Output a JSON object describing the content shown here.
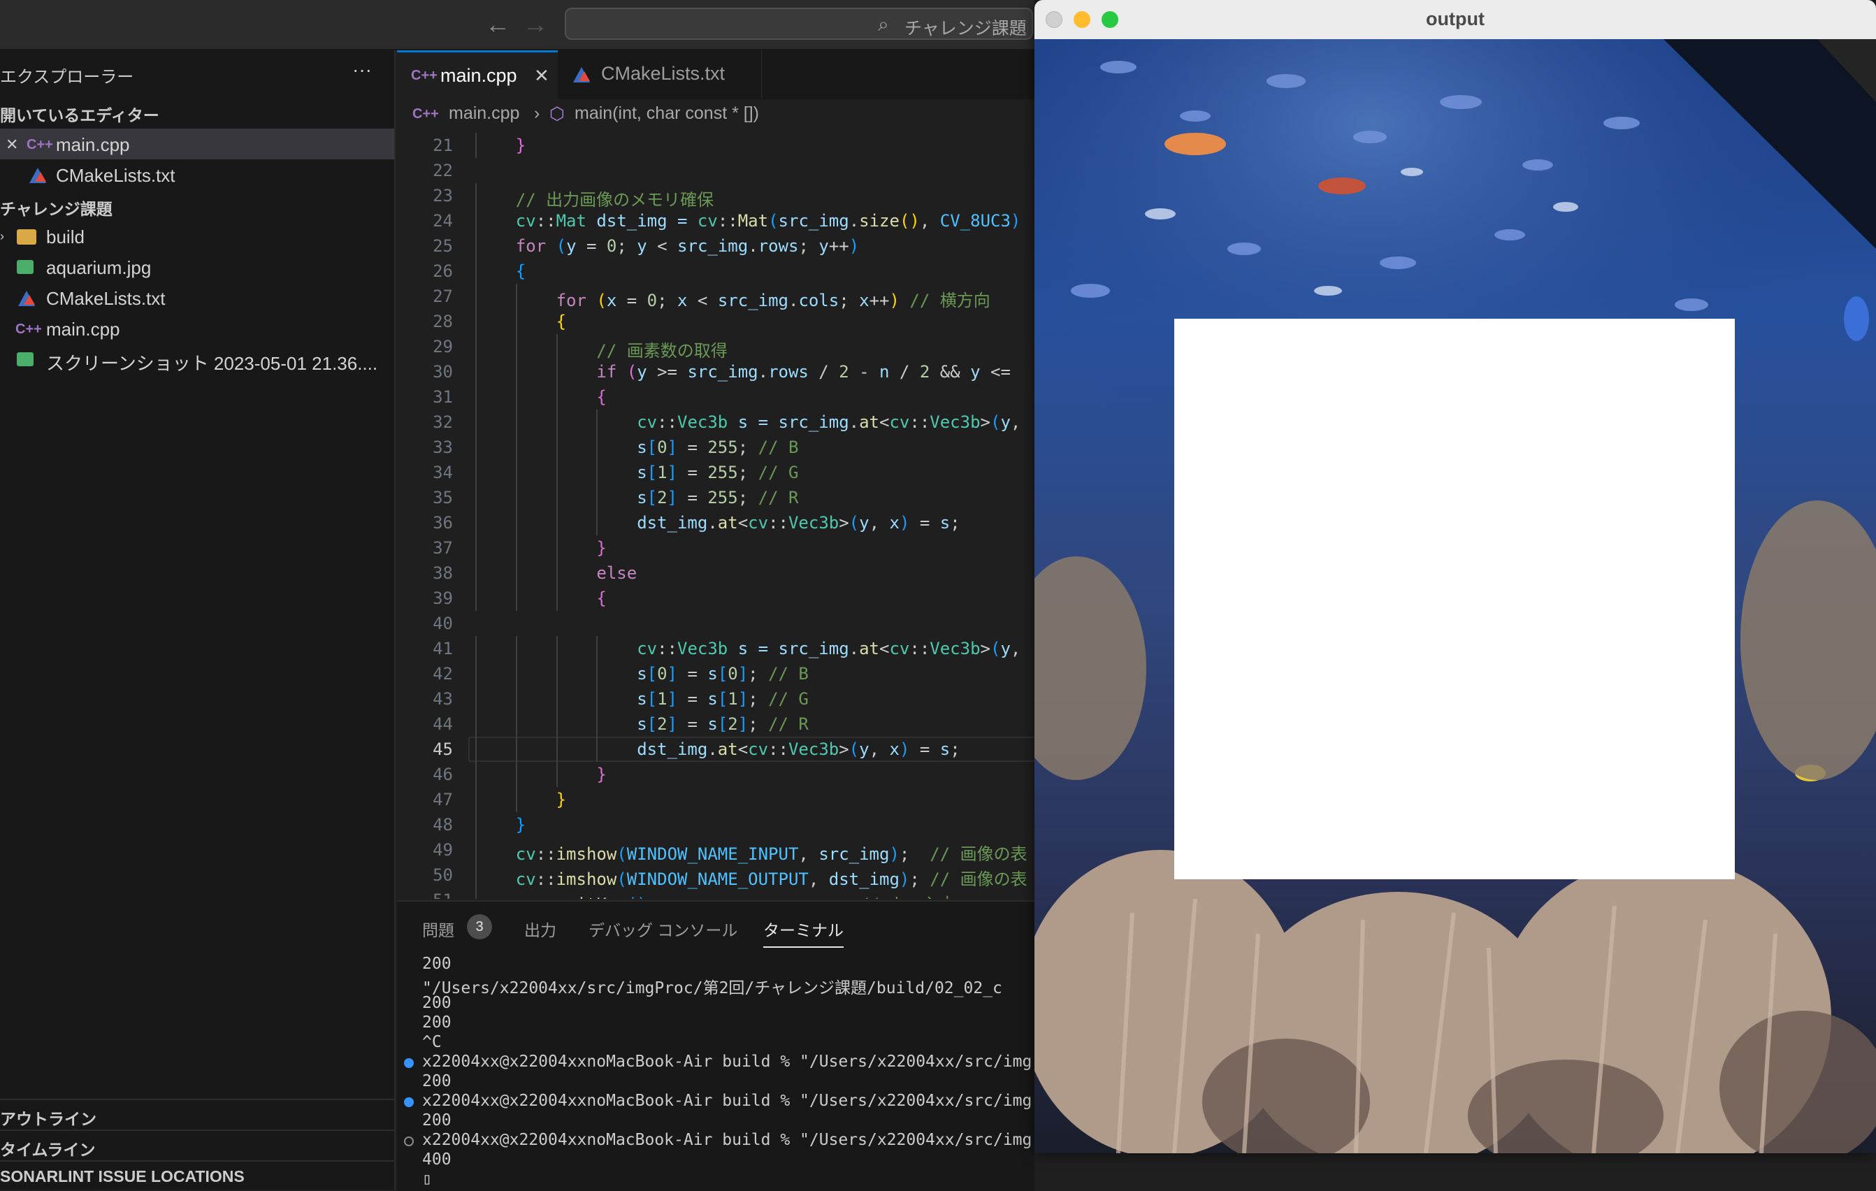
{
  "titlebar": {
    "search_text": "チャレンジ課題"
  },
  "sidebar": {
    "title": "エクスプローラー",
    "more": "···",
    "open_editors_header": "開いているエディター",
    "open_editors": [
      {
        "name": "main.cpp",
        "icon": "C++",
        "active": true
      },
      {
        "name": "CMakeLists.txt",
        "icon": "cmake",
        "active": false
      }
    ],
    "folder_header": "チャレンジ課題",
    "files": [
      {
        "name": "build",
        "icon": "folder"
      },
      {
        "name": "aquarium.jpg",
        "icon": "image"
      },
      {
        "name": "CMakeLists.txt",
        "icon": "cmake"
      },
      {
        "name": "main.cpp",
        "icon": "C++"
      },
      {
        "name": "スクリーンショット 2023-05-01 21.36....",
        "icon": "image"
      }
    ],
    "bottom_sections": [
      "アウトライン",
      "タイムライン",
      "SONARLINT ISSUE LOCATIONS"
    ]
  },
  "editor": {
    "tabs": [
      {
        "label": "main.cpp",
        "icon": "C++",
        "active": true
      },
      {
        "label": "CMakeLists.txt",
        "icon": "cmake",
        "active": false
      }
    ],
    "breadcrumb": [
      "main.cpp",
      "main(int, char const * [])"
    ],
    "current_line": 45,
    "lines": [
      {
        "n": 21,
        "indent": 1,
        "t": [
          [
            "}",
            "b2"
          ]
        ]
      },
      {
        "n": 22,
        "indent": 0,
        "t": []
      },
      {
        "n": 23,
        "indent": 1,
        "t": [
          [
            "// 出力画像のメモリ確保",
            "cm"
          ]
        ]
      },
      {
        "n": 24,
        "indent": 1,
        "t": [
          [
            "cv",
            "ty"
          ],
          [
            "::",
            ""
          ],
          [
            "Mat",
            "ty"
          ],
          [
            " dst_img = ",
            "vr"
          ],
          [
            "cv",
            "ty"
          ],
          [
            "::",
            ""
          ],
          [
            "Mat",
            "fn"
          ],
          [
            "(",
            "b3"
          ],
          [
            "src_img",
            "vr"
          ],
          [
            ".",
            ""
          ],
          [
            "size",
            "fn"
          ],
          [
            "()",
            "b1"
          ],
          [
            ", ",
            ""
          ],
          [
            "CV_8UC3",
            "cn"
          ],
          [
            ")",
            "b3"
          ]
        ]
      },
      {
        "n": 25,
        "indent": 1,
        "t": [
          [
            "for",
            "kw"
          ],
          [
            " (",
            "b3"
          ],
          [
            "y",
            "vr"
          ],
          [
            " = ",
            ""
          ],
          [
            "0",
            "nm"
          ],
          [
            "; ",
            ""
          ],
          [
            "y",
            "vr"
          ],
          [
            " < ",
            ""
          ],
          [
            "src_img",
            "vr"
          ],
          [
            ".",
            ""
          ],
          [
            "rows",
            "vr"
          ],
          [
            "; ",
            ""
          ],
          [
            "y",
            "vr"
          ],
          [
            "++",
            ""
          ],
          [
            ")",
            "b3"
          ]
        ]
      },
      {
        "n": 26,
        "indent": 1,
        "t": [
          [
            "{",
            "b3"
          ]
        ]
      },
      {
        "n": 27,
        "indent": 2,
        "t": [
          [
            "for",
            "kw"
          ],
          [
            " (",
            "b1"
          ],
          [
            "x",
            "vr"
          ],
          [
            " = ",
            ""
          ],
          [
            "0",
            "nm"
          ],
          [
            "; ",
            ""
          ],
          [
            "x",
            "vr"
          ],
          [
            " < ",
            ""
          ],
          [
            "src_img",
            "vr"
          ],
          [
            ".",
            ""
          ],
          [
            "cols",
            "vr"
          ],
          [
            "; ",
            ""
          ],
          [
            "x",
            "vr"
          ],
          [
            "++",
            ""
          ],
          [
            ")",
            "b1"
          ],
          [
            " // 横方向",
            "cm"
          ]
        ]
      },
      {
        "n": 28,
        "indent": 2,
        "t": [
          [
            "{",
            "b1"
          ]
        ]
      },
      {
        "n": 29,
        "indent": 3,
        "t": [
          [
            "// 画素数の取得",
            "cm"
          ]
        ]
      },
      {
        "n": 30,
        "indent": 3,
        "t": [
          [
            "if",
            "kw"
          ],
          [
            " (",
            "b2"
          ],
          [
            "y",
            "vr"
          ],
          [
            " >= ",
            ""
          ],
          [
            "src_img",
            "vr"
          ],
          [
            ".",
            ""
          ],
          [
            "rows",
            "vr"
          ],
          [
            " / ",
            ""
          ],
          [
            "2",
            "nm"
          ],
          [
            " - ",
            ""
          ],
          [
            "n",
            "vr"
          ],
          [
            " / ",
            ""
          ],
          [
            "2",
            "nm"
          ],
          [
            " && ",
            ""
          ],
          [
            "y",
            "vr"
          ],
          [
            " <=",
            ""
          ]
        ]
      },
      {
        "n": 31,
        "indent": 3,
        "t": [
          [
            "{",
            "b2"
          ]
        ]
      },
      {
        "n": 32,
        "indent": 4,
        "t": [
          [
            "cv",
            "ty"
          ],
          [
            "::",
            ""
          ],
          [
            "Vec3b",
            "ty"
          ],
          [
            " s = ",
            "vr"
          ],
          [
            "src_img",
            "vr"
          ],
          [
            ".",
            ""
          ],
          [
            "at",
            "fn"
          ],
          [
            "<",
            ""
          ],
          [
            "cv",
            "ty"
          ],
          [
            "::",
            ""
          ],
          [
            "Vec3b",
            "ty"
          ],
          [
            ">",
            ""
          ],
          [
            "(",
            "b3"
          ],
          [
            "y",
            "vr"
          ],
          [
            ",",
            ""
          ]
        ]
      },
      {
        "n": 33,
        "indent": 4,
        "t": [
          [
            "s",
            "vr"
          ],
          [
            "[",
            "b3"
          ],
          [
            "0",
            "nm"
          ],
          [
            "]",
            "b3"
          ],
          [
            " = ",
            ""
          ],
          [
            "255",
            "nm"
          ],
          [
            "; ",
            ""
          ],
          [
            "// B",
            "cm"
          ]
        ]
      },
      {
        "n": 34,
        "indent": 4,
        "t": [
          [
            "s",
            "vr"
          ],
          [
            "[",
            "b3"
          ],
          [
            "1",
            "nm"
          ],
          [
            "]",
            "b3"
          ],
          [
            " = ",
            ""
          ],
          [
            "255",
            "nm"
          ],
          [
            "; ",
            ""
          ],
          [
            "// G",
            "cm"
          ]
        ]
      },
      {
        "n": 35,
        "indent": 4,
        "t": [
          [
            "s",
            "vr"
          ],
          [
            "[",
            "b3"
          ],
          [
            "2",
            "nm"
          ],
          [
            "]",
            "b3"
          ],
          [
            " = ",
            ""
          ],
          [
            "255",
            "nm"
          ],
          [
            "; ",
            ""
          ],
          [
            "// R",
            "cm"
          ]
        ]
      },
      {
        "n": 36,
        "indent": 4,
        "t": [
          [
            "dst_img",
            "vr"
          ],
          [
            ".",
            ""
          ],
          [
            "at",
            "fn"
          ],
          [
            "<",
            ""
          ],
          [
            "cv",
            "ty"
          ],
          [
            "::",
            ""
          ],
          [
            "Vec3b",
            "ty"
          ],
          [
            ">",
            ""
          ],
          [
            "(",
            "b3"
          ],
          [
            "y",
            "vr"
          ],
          [
            ", ",
            ""
          ],
          [
            "x",
            "vr"
          ],
          [
            ")",
            "b3"
          ],
          [
            " = ",
            ""
          ],
          [
            "s",
            "vr"
          ],
          [
            ";",
            ""
          ]
        ]
      },
      {
        "n": 37,
        "indent": 3,
        "t": [
          [
            "}",
            "b2"
          ]
        ]
      },
      {
        "n": 38,
        "indent": 3,
        "t": [
          [
            "else",
            "kw"
          ]
        ]
      },
      {
        "n": 39,
        "indent": 3,
        "t": [
          [
            "{",
            "b2"
          ]
        ]
      },
      {
        "n": 40,
        "indent": 0,
        "t": []
      },
      {
        "n": 41,
        "indent": 4,
        "t": [
          [
            "cv",
            "ty"
          ],
          [
            "::",
            ""
          ],
          [
            "Vec3b",
            "ty"
          ],
          [
            " s = ",
            "vr"
          ],
          [
            "src_img",
            "vr"
          ],
          [
            ".",
            ""
          ],
          [
            "at",
            "fn"
          ],
          [
            "<",
            ""
          ],
          [
            "cv",
            "ty"
          ],
          [
            "::",
            ""
          ],
          [
            "Vec3b",
            "ty"
          ],
          [
            ">",
            ""
          ],
          [
            "(",
            "b3"
          ],
          [
            "y",
            "vr"
          ],
          [
            ",",
            ""
          ]
        ]
      },
      {
        "n": 42,
        "indent": 4,
        "t": [
          [
            "s",
            "vr"
          ],
          [
            "[",
            "b3"
          ],
          [
            "0",
            "nm"
          ],
          [
            "]",
            "b3"
          ],
          [
            " = ",
            ""
          ],
          [
            "s",
            "vr"
          ],
          [
            "[",
            "b3"
          ],
          [
            "0",
            "nm"
          ],
          [
            "]",
            "b3"
          ],
          [
            "; ",
            ""
          ],
          [
            "// B",
            "cm"
          ]
        ]
      },
      {
        "n": 43,
        "indent": 4,
        "t": [
          [
            "s",
            "vr"
          ],
          [
            "[",
            "b3"
          ],
          [
            "1",
            "nm"
          ],
          [
            "]",
            "b3"
          ],
          [
            " = ",
            ""
          ],
          [
            "s",
            "vr"
          ],
          [
            "[",
            "b3"
          ],
          [
            "1",
            "nm"
          ],
          [
            "]",
            "b3"
          ],
          [
            "; ",
            ""
          ],
          [
            "// G",
            "cm"
          ]
        ]
      },
      {
        "n": 44,
        "indent": 4,
        "t": [
          [
            "s",
            "vr"
          ],
          [
            "[",
            "b3"
          ],
          [
            "2",
            "nm"
          ],
          [
            "]",
            "b3"
          ],
          [
            " = ",
            ""
          ],
          [
            "s",
            "vr"
          ],
          [
            "[",
            "b3"
          ],
          [
            "2",
            "nm"
          ],
          [
            "]",
            "b3"
          ],
          [
            "; ",
            ""
          ],
          [
            "// R",
            "cm"
          ]
        ]
      },
      {
        "n": 45,
        "indent": 4,
        "t": [
          [
            "dst_img",
            "vr"
          ],
          [
            ".",
            ""
          ],
          [
            "at",
            "fn"
          ],
          [
            "<",
            ""
          ],
          [
            "cv",
            "ty"
          ],
          [
            "::",
            ""
          ],
          [
            "Vec3b",
            "ty"
          ],
          [
            ">",
            ""
          ],
          [
            "(",
            "b3"
          ],
          [
            "y",
            "vr"
          ],
          [
            ", ",
            ""
          ],
          [
            "x",
            "vr"
          ],
          [
            ")",
            "b3"
          ],
          [
            " = ",
            ""
          ],
          [
            "s",
            "vr"
          ],
          [
            ";",
            ""
          ]
        ]
      },
      {
        "n": 46,
        "indent": 3,
        "t": [
          [
            "}",
            "b2"
          ]
        ]
      },
      {
        "n": 47,
        "indent": 2,
        "t": [
          [
            "}",
            "b1"
          ]
        ]
      },
      {
        "n": 48,
        "indent": 1,
        "t": [
          [
            "}",
            "b3"
          ]
        ]
      },
      {
        "n": 49,
        "indent": 1,
        "t": [
          [
            "cv",
            "ty"
          ],
          [
            "::",
            ""
          ],
          [
            "imshow",
            "fn"
          ],
          [
            "(",
            "b3"
          ],
          [
            "WINDOW_NAME_INPUT",
            "cn"
          ],
          [
            ", ",
            ""
          ],
          [
            "src_img",
            "vr"
          ],
          [
            ")",
            "b3"
          ],
          [
            ";  ",
            ""
          ],
          [
            "// 画像の表",
            "cm"
          ]
        ]
      },
      {
        "n": 50,
        "indent": 1,
        "t": [
          [
            "cv",
            "ty"
          ],
          [
            "::",
            ""
          ],
          [
            "imshow",
            "fn"
          ],
          [
            "(",
            "b3"
          ],
          [
            "WINDOW_NAME_OUTPUT",
            "cn"
          ],
          [
            ", ",
            ""
          ],
          [
            "dst_img",
            "vr"
          ],
          [
            ")",
            "b3"
          ],
          [
            "; ",
            ""
          ],
          [
            "// 画像の表",
            "cm"
          ]
        ]
      },
      {
        "n": 51,
        "indent": 1,
        "t": [
          [
            "cv",
            "ty"
          ],
          [
            "::",
            ""
          ],
          [
            "waitKey",
            "fn"
          ],
          [
            "()",
            "b3"
          ],
          [
            ";",
            ""
          ],
          [
            "                    // キー入力",
            "cm"
          ]
        ]
      }
    ]
  },
  "panel": {
    "tabs": [
      {
        "label": "問題",
        "badge": "3",
        "active": false
      },
      {
        "label": "出力",
        "active": false
      },
      {
        "label": "デバッグ コンソール",
        "active": false
      },
      {
        "label": "ターミナル",
        "active": true
      }
    ],
    "terminal_lines": [
      {
        "text": "200",
        "dot": null
      },
      {
        "text": "\"/Users/x22004xx/src/imgProc/第2回/チャレンジ課題/build/02_02_c",
        "dot": null
      },
      {
        "text": "200",
        "dot": null
      },
      {
        "text": "200",
        "dot": null
      },
      {
        "text": "^C",
        "dot": null
      },
      {
        "text": "x22004xx@x22004xxnoMacBook-Air build % \"/Users/x22004xx/src/img",
        "dot": "filled"
      },
      {
        "text": "200",
        "dot": null
      },
      {
        "text": "x22004xx@x22004xxnoMacBook-Air build % \"/Users/x22004xx/src/img",
        "dot": "filled"
      },
      {
        "text": "200",
        "dot": null
      },
      {
        "text": "x22004xx@x22004xxnoMacBook-Air build % \"/Users/x22004xx/src/img",
        "dot": "hollow"
      },
      {
        "text": "400",
        "dot": null
      },
      {
        "text": "▯",
        "dot": null
      }
    ]
  },
  "output_window": {
    "title": "output",
    "image_description_name": "aquarium-image",
    "colors": {
      "close": "#fe5f57",
      "minimize": "#febc2e",
      "zoom": "#28c840",
      "accent": "#0078d4"
    }
  }
}
